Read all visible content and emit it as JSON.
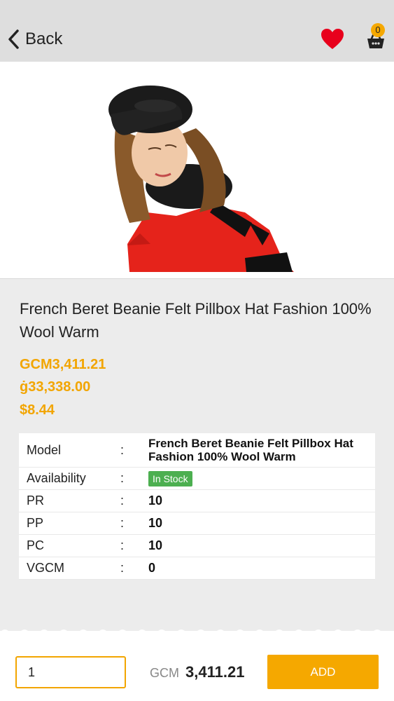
{
  "header": {
    "back_label": "Back",
    "cart_count": "0"
  },
  "product": {
    "title": "French Beret Beanie Felt Pillbox Hat Fashion 100% Wool Warm",
    "prices": [
      "GCM3,411.21",
      "ġ33,338.00",
      "$8.44"
    ],
    "specs": [
      {
        "label": "Model",
        "sep": ":",
        "value": "French Beret Beanie Felt Pillbox Hat Fashion 100% Wool Warm"
      },
      {
        "label": "Availability",
        "sep": ":",
        "value": "In Stock"
      },
      {
        "label": "PR",
        "sep": ":",
        "value": "10"
      },
      {
        "label": "PP",
        "sep": ":",
        "value": "10"
      },
      {
        "label": "PC",
        "sep": ":",
        "value": "10"
      },
      {
        "label": "VGCM",
        "sep": ":",
        "value": "0"
      }
    ]
  },
  "bottom": {
    "quantity": "1",
    "currency": "GCM",
    "total": "3,411.21",
    "add_label": "ADD"
  },
  "colors": {
    "accent": "#f5a800",
    "stock_badge": "#4caf50",
    "heart": "#e8001c"
  },
  "icons": [
    "chevron-left-icon",
    "heart-icon",
    "cart-icon"
  ]
}
